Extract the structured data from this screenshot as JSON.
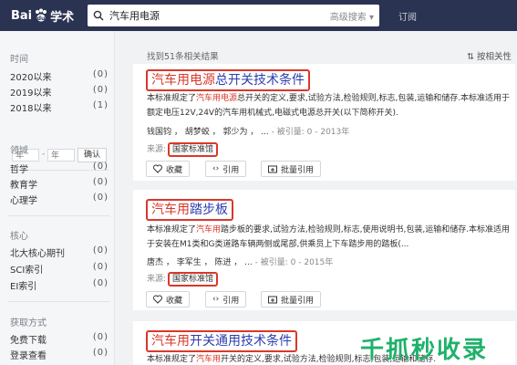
{
  "header": {
    "logo_text": "学术",
    "search_value": "汽车用电源",
    "advanced_search": "高级搜索",
    "subscribe": "订阅"
  },
  "sidebar": {
    "time_title": "时间",
    "time_items": [
      {
        "label": "2020以来",
        "count": "(0)"
      },
      {
        "label": "2019以来",
        "count": "(0)"
      },
      {
        "label": "2018以来",
        "count": "(1)"
      }
    ],
    "year_from_placeholder": "年",
    "year_to_placeholder": "年",
    "confirm": "确认",
    "field_title": "领域",
    "field_items": [
      {
        "label": "哲学",
        "count": "(0)"
      },
      {
        "label": "教育学",
        "count": "(0)"
      },
      {
        "label": "心理学",
        "count": "(0)"
      }
    ],
    "core_title": "核心",
    "core_items": [
      {
        "label": "北大核心期刊",
        "count": "(0)"
      },
      {
        "label": "SCI索引",
        "count": "(0)"
      },
      {
        "label": "EI索引",
        "count": "(0)"
      }
    ],
    "access_title": "获取方式",
    "access_items": [
      {
        "label": "免费下载",
        "count": "(0)"
      },
      {
        "label": "登录查看",
        "count": "(0)"
      }
    ]
  },
  "results": {
    "found": "找到51条相关结果",
    "sort": "按相关性",
    "items": [
      {
        "title_hl": "汽车用电源",
        "title_rest": "总开关技术条件",
        "snippet_pre": "本标准规定了",
        "snippet_hl": "汽车用电源",
        "snippet_post": "总开关的定义,要求,试验方法,检验规则,标志,包装,运输和储存.本标准适用于额定电压12V,24V的汽车用机械式,电磁式电源总开关(以下简称开关).",
        "authors": "钱国钧 ， 胡梦蛟 ， 郭少为 ， ...",
        "cited": "- 被引量: 0",
        "year": "- 2013年",
        "source_label": "来源:",
        "source": "国家标准馆",
        "collect": "收藏",
        "cite": "引用",
        "batch_cite": "批量引用"
      },
      {
        "title_hl": "汽车用",
        "title_rest": "踏步板",
        "snippet_pre": "本标准规定了",
        "snippet_hl": "汽车用",
        "snippet_post": "踏步板的要求,试验方法,检验规则,标志,使用说明书,包装,运输和储存.本标准适用于安装在M1类和G类道路车辆两侧或尾部,供乘员上下车踏步用的踏板(...",
        "authors": "唐杰 ， 李军生 ， 陈进 ， ...",
        "cited": "- 被引量: 0",
        "year": "- 2015年",
        "source_label": "来源:",
        "source": "国家标准馆",
        "collect": "收藏",
        "cite": "引用",
        "batch_cite": "批量引用"
      },
      {
        "title_hl": "汽车用",
        "title_rest": "开关通用技术条件",
        "snippet_pre": "本标准规定了",
        "snippet_hl": "汽车用",
        "snippet_post": "开关的定义,要求,试验方法,检验规则,标志,包装,运输和储存."
      }
    ]
  },
  "watermark": "千抓秒收录",
  "colors": {
    "header": "#2b3352",
    "highlight": "#d9382a",
    "title": "#2c3fb0",
    "watermark": "#1fb16b"
  }
}
